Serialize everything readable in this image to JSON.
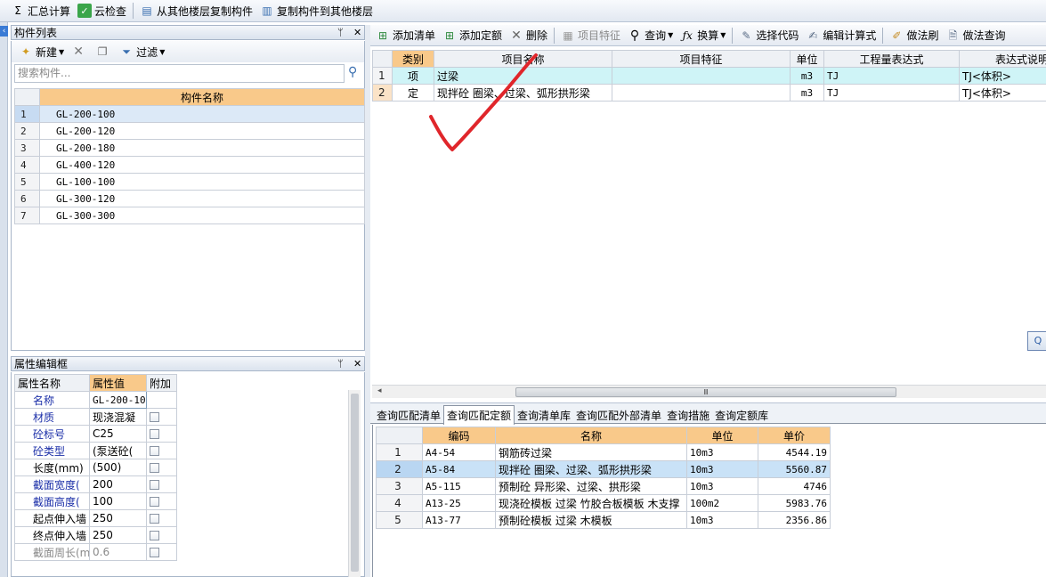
{
  "toolbar": {
    "sum_calc": "汇总计算",
    "cloud_check": "云检查",
    "copy_from_floor": "从其他楼层复制构件",
    "copy_to_floor": "复制构件到其他楼层"
  },
  "component_list": {
    "title": "构件列表",
    "new_label": "新建",
    "filter_label": "过滤",
    "search_placeholder": "搜索构件...",
    "column_header": "构件名称",
    "rows": [
      {
        "num": "1",
        "name": "GL-200-100"
      },
      {
        "num": "2",
        "name": "GL-200-120"
      },
      {
        "num": "3",
        "name": "GL-200-180"
      },
      {
        "num": "4",
        "name": "GL-400-120"
      },
      {
        "num": "5",
        "name": "GL-100-100"
      },
      {
        "num": "6",
        "name": "GL-300-120"
      },
      {
        "num": "7",
        "name": "GL-300-300"
      }
    ]
  },
  "property_editor": {
    "title": "属性编辑框",
    "headers": {
      "name": "属性名称",
      "value": "属性值",
      "extra": "附加"
    },
    "rows": [
      {
        "name": "名称",
        "value": "GL-200-10",
        "blue": true,
        "check": false
      },
      {
        "name": "材质",
        "value": "现浇混凝",
        "blue": true,
        "check": true
      },
      {
        "name": "砼标号",
        "value": "C25",
        "blue": true,
        "check": true
      },
      {
        "name": "砼类型",
        "value": "(泵送砼(",
        "blue": true,
        "check": true
      },
      {
        "name": "长度(mm)",
        "value": "(500)",
        "blue": false,
        "check": true
      },
      {
        "name": "截面宽度(",
        "value": "200",
        "blue": true,
        "check": true
      },
      {
        "name": "截面高度(",
        "value": "100",
        "blue": true,
        "check": true
      },
      {
        "name": "起点伸入墙",
        "value": "250",
        "blue": false,
        "check": true
      },
      {
        "name": "终点伸入墙",
        "value": "250",
        "blue": false,
        "check": true
      },
      {
        "name": "截面周长(m",
        "value": "0.6",
        "blue": false,
        "check": true,
        "grey": true
      }
    ]
  },
  "right_toolbar": {
    "add_list": "添加清单",
    "add_quota": "添加定额",
    "delete": "删除",
    "item_feature": "项目特征",
    "query": "查询",
    "convert": "换算",
    "select_code": "选择代码",
    "edit_formula": "编辑计算式",
    "method_brush": "做法刷",
    "method_query": "做法查询"
  },
  "upper_grid": {
    "headers": [
      "类别",
      "项目名称",
      "项目特征",
      "单位",
      "工程量表达式",
      "表达式说明"
    ],
    "rows": [
      {
        "num": "1",
        "type": "项",
        "name": "过梁",
        "feature": "",
        "unit": "m3",
        "expr": "TJ",
        "desc": "TJ<体积>"
      },
      {
        "num": "2",
        "type": "定",
        "name": "现拌砼 圈梁、过梁、弧形拱形梁",
        "feature": "",
        "unit": "m3",
        "expr": "TJ",
        "desc": "TJ<体积>"
      }
    ]
  },
  "bottom_tabs": [
    "查询匹配清单",
    "查询匹配定额",
    "查询清单库",
    "查询匹配外部清单",
    "查询措施",
    "查询定额库"
  ],
  "lower_grid": {
    "headers": [
      "编码",
      "名称",
      "单位",
      "单价"
    ],
    "rows": [
      {
        "num": "1",
        "code": "A4-54",
        "name": "钢筋砖过梁",
        "unit": "10m3",
        "price": "4544.19"
      },
      {
        "num": "2",
        "code": "A5-84",
        "name": "现拌砼 圈梁、过梁、弧形拱形梁",
        "unit": "10m3",
        "price": "5560.87"
      },
      {
        "num": "3",
        "code": "A5-115",
        "name": "预制砼 异形梁、过梁、拱形梁",
        "unit": "10m3",
        "price": "4746"
      },
      {
        "num": "4",
        "code": "A13-25",
        "name": "现浇砼模板 过梁 竹胶合板模板 木支撑",
        "unit": "100m2",
        "price": "5983.76"
      },
      {
        "num": "5",
        "code": "A13-77",
        "name": "预制砼模板 过梁 木模板",
        "unit": "10m3",
        "price": "2356.86"
      }
    ]
  },
  "misc": {
    "scroll_glyph": "Ⅲ",
    "side_button": "Q"
  }
}
